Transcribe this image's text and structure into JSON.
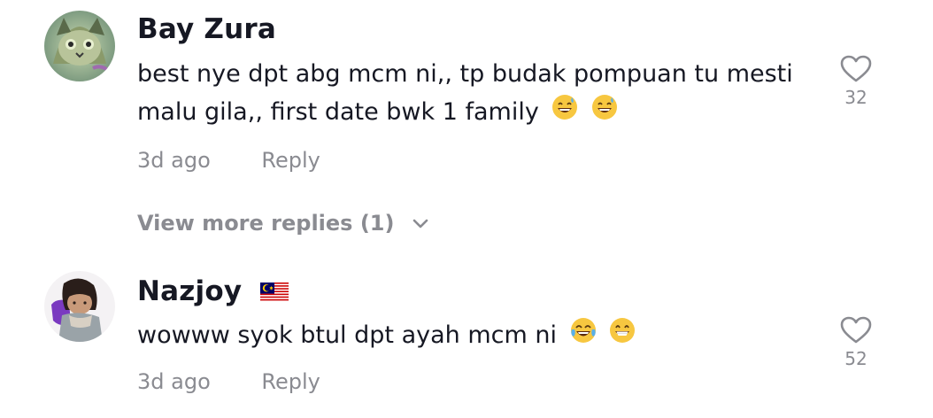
{
  "comments": [
    {
      "username": "Bay Zura",
      "line1": "best nye dpt abg mcm ni,, tp budak pompuan tu mesti",
      "line2": "malu gila,, first date bwk 1 family",
      "emojis": [
        "grinning-sweat-emoji",
        "grinning-sweat-emoji"
      ],
      "time": "3d ago",
      "reply_label": "Reply",
      "likes": "32",
      "avatar_icon": "cat-avatar"
    },
    {
      "username": "Nazjoy",
      "flag_icon": "malaysia-flag-icon",
      "line1": "wowww syok btul dpt ayah mcm ni",
      "emojis": [
        "tears-of-joy-emoji",
        "beaming-face-emoji"
      ],
      "time": "3d ago",
      "reply_label": "Reply",
      "likes": "52",
      "avatar_icon": "person-avatar"
    }
  ],
  "view_more": "View more replies (1)",
  "colors": {
    "primary_text": "#161823",
    "secondary_text": "#8a8b91"
  }
}
